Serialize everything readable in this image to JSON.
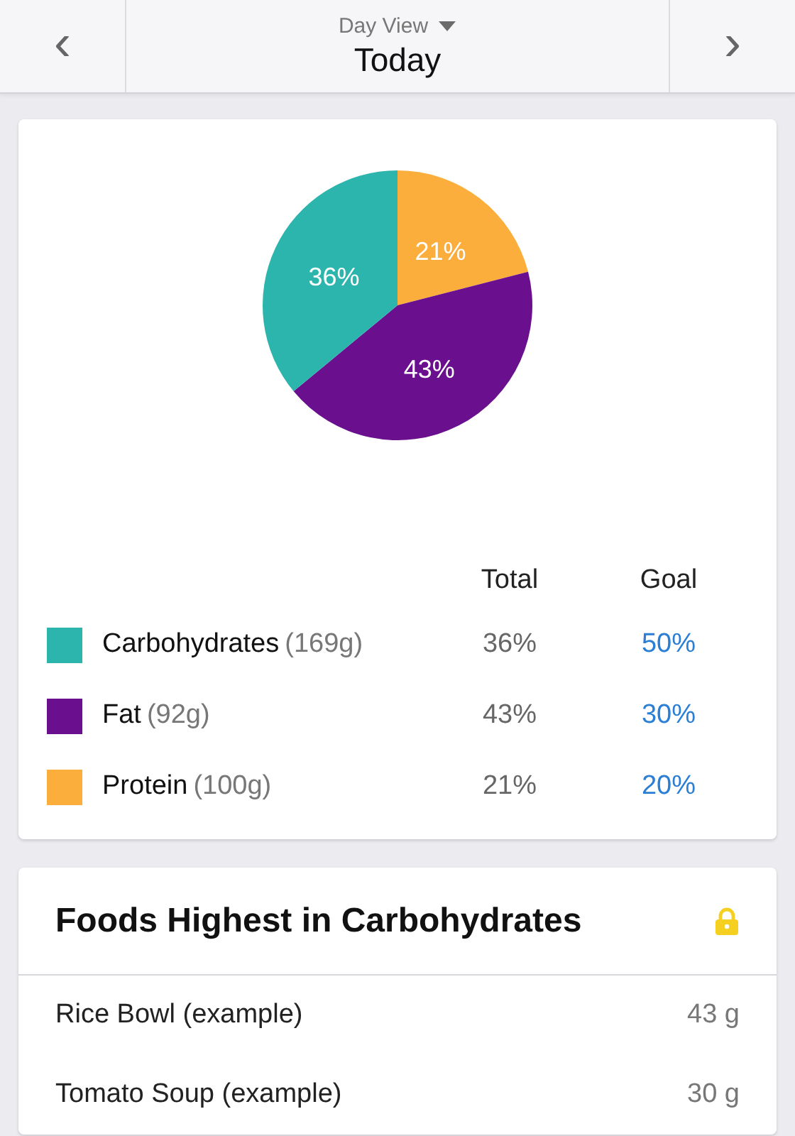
{
  "header": {
    "prev": "‹",
    "subtitle": "Day View",
    "title": "Today",
    "next": "›"
  },
  "macro_card": {
    "chart_data": {
      "type": "pie",
      "values": [
        36,
        43,
        21
      ],
      "value_labels": [
        "36%",
        "43%",
        "21%"
      ]
    },
    "columns": [
      "Total",
      "Goal"
    ],
    "macros": [
      {
        "name": "Carbohydrates",
        "amount": "(169g)",
        "total": "36%",
        "goal": "50%",
        "color": "#2cb5ad"
      },
      {
        "name": "Fat",
        "amount": "(92g)",
        "total": "43%",
        "goal": "30%",
        "color": "#6a0f8e"
      },
      {
        "name": "Protein",
        "amount": "(100g)",
        "total": "21%",
        "goal": "20%",
        "color": "#fbae3c"
      }
    ]
  },
  "foods_card": {
    "title": "Foods Highest in Carbohydrates",
    "locked": true,
    "items": [
      {
        "name": "Rice Bowl (example)",
        "amount": "43 g"
      },
      {
        "name": "Tomato Soup (example)",
        "amount": "30 g"
      }
    ]
  }
}
